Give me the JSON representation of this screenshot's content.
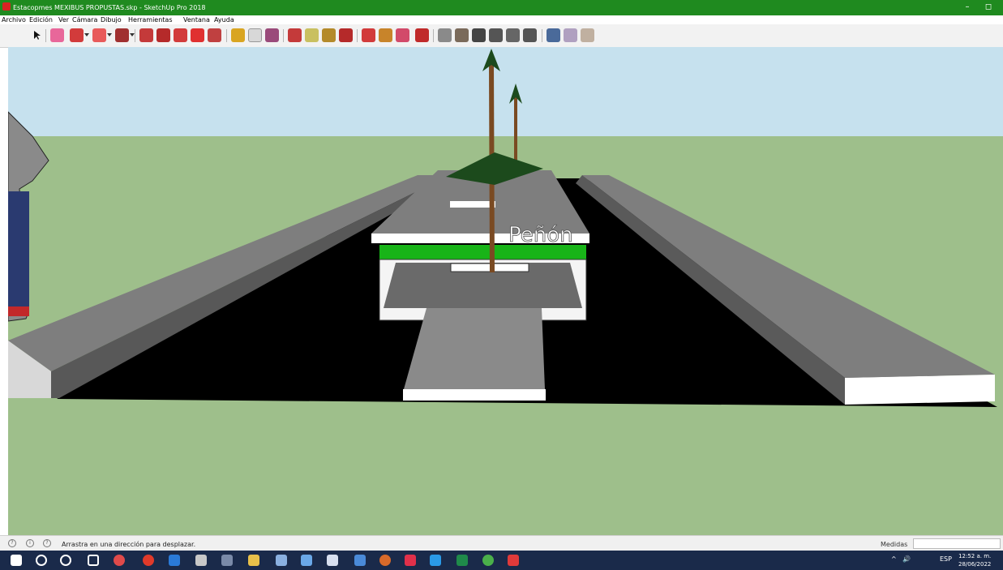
{
  "window": {
    "title": "Estacopmes MEXIBUS PROPUSTAS.skp - SketchUp Pro 2018",
    "minimize_glyph": "–",
    "restore_glyph": "◻"
  },
  "menu": [
    "Archivo",
    "Edición",
    "Ver",
    "Cámara",
    "Dibujo",
    "Herramientas",
    "Ventana",
    "Ayuda"
  ],
  "toolbar": {
    "tools": [
      "select-icon",
      "eraser-icon",
      "pencil-icon",
      "arc-icon",
      "rectangle-icon",
      "push-pull-icon",
      "follow-me-icon",
      "move-icon",
      "rotate-icon",
      "scale-icon",
      "tape-measure-icon",
      "text-icon",
      "paint-bucket-icon",
      "orbit-icon",
      "pan-icon",
      "zoom-icon",
      "zoom-extents-icon",
      "warehouse-icon",
      "extension-warehouse-icon",
      "share-model-icon",
      "ruby-icon",
      "iso-view-icon",
      "top-view-icon",
      "front-view-icon",
      "right-view-icon",
      "back-view-icon",
      "left-view-icon",
      "section-plane-icon",
      "layout-icon",
      "send-to-layout-icon"
    ]
  },
  "scene": {
    "sign_text": "Peñón",
    "colors": {
      "sky": "#c6e1ee",
      "grass": "#9ebf8b",
      "road": "#000000",
      "platform_top": "#7e7e7e",
      "platform_side": "#ffffff",
      "green_band": "#18b418",
      "paving": "#8a8a8a",
      "tree_trunk": "#7a4a22",
      "tree_leaf": "#1c4a1c"
    }
  },
  "statusbar": {
    "hint": "Arrastra en una dirección para desplazar.",
    "measure_label": "Medidas",
    "measure_value": ""
  },
  "taskbar": {
    "apps": [
      "start-icon",
      "search-icon",
      "cortana-icon",
      "task-view-icon",
      "chrome-icon",
      "opera-icon",
      "outlook-icon",
      "chat-icon",
      "bandicam-icon",
      "explorer-icon",
      "weather-icon",
      "edge-icon",
      "feather-icon",
      "photos-icon",
      "powerpoint-icon",
      "opera-gx-icon",
      "maps-icon",
      "excel-icon",
      "chrome-alt-icon",
      "sketchup-icon"
    ],
    "tray": {
      "chevron": "^",
      "volume": "🔊",
      "language": "ESP",
      "time": "12:52 a. m.",
      "date": "28/06/2022"
    }
  }
}
